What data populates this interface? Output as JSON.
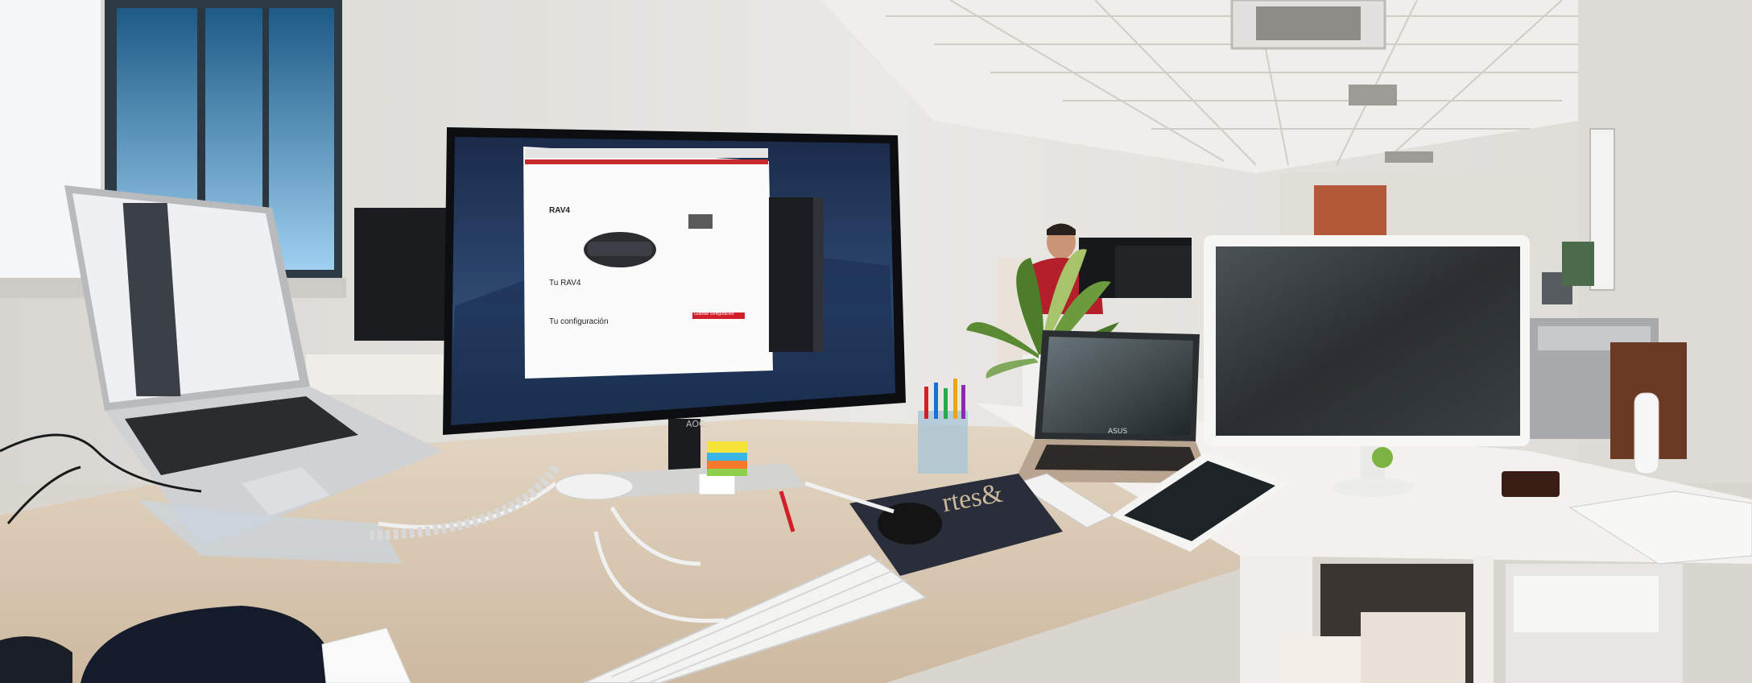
{
  "scene": {
    "monitor_brand": "AOC",
    "laptop_brand": "ASUS",
    "mousepad_text": "rtes&",
    "browser_page": {
      "title": "RAV4",
      "subtitle": "Tu RAV4",
      "section": "Tu configuración",
      "cta": "Guardar configuración"
    }
  },
  "colors": {
    "wall": "#e6e4df",
    "desk": "#d8c8b2",
    "ceiling": "#ecebe7",
    "shirt": "#b3202a",
    "accent_red": "#d01f2a"
  }
}
